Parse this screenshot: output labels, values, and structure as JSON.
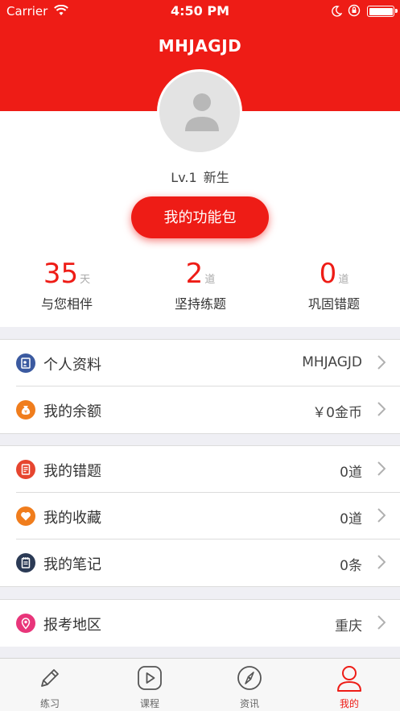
{
  "status_bar": {
    "carrier": "Carrier",
    "time": "4:50 PM"
  },
  "header": {
    "title": "MHJAGJD"
  },
  "profile": {
    "level": "Lv.1",
    "level_name": "新生",
    "function_button": "我的功能包"
  },
  "stats": [
    {
      "number": "35",
      "unit": "天",
      "label": "与您相伴"
    },
    {
      "number": "2",
      "unit": "道",
      "label": "坚持练题"
    },
    {
      "number": "0",
      "unit": "道",
      "label": "巩固错题"
    }
  ],
  "sections": [
    [
      {
        "icon": "profile-card-icon",
        "title": "个人资料",
        "value": "MHJAGJD",
        "color": "#3b5aa0"
      },
      {
        "icon": "money-bag-icon",
        "title": "我的余额",
        "value": "￥0金币",
        "color": "#f07d1d"
      }
    ],
    [
      {
        "icon": "wrong-question-icon",
        "title": "我的错题",
        "value": "0道",
        "color": "#e6452f"
      },
      {
        "icon": "heart-icon",
        "title": "我的收藏",
        "value": "0道",
        "color": "#f07d1d"
      },
      {
        "icon": "notebook-icon",
        "title": "我的笔记",
        "value": "0条",
        "color": "#2b3a55"
      }
    ],
    [
      {
        "icon": "location-pin-icon",
        "title": "报考地区",
        "value": "重庆",
        "color": "#e8357a"
      }
    ]
  ],
  "tabs": [
    {
      "icon": "pencil-icon",
      "label": "练习"
    },
    {
      "icon": "play-icon",
      "label": "课程"
    },
    {
      "icon": "compass-icon",
      "label": "资讯"
    },
    {
      "icon": "person-icon",
      "label": "我的",
      "active": true
    }
  ],
  "colors": {
    "brand_red": "#ee1c16"
  }
}
